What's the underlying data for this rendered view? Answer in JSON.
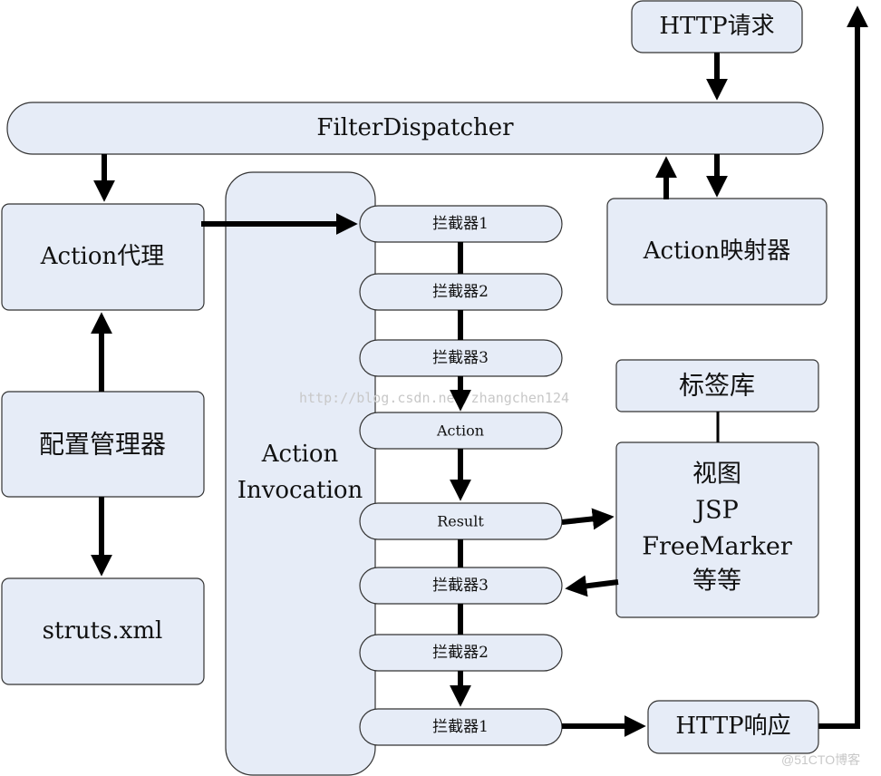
{
  "nodes": {
    "http_request": "HTTP请求",
    "filter_dispatcher": "FilterDispatcher",
    "action_proxy": "Action代理",
    "config_manager": "配置管理器",
    "struts_xml": "struts.xml",
    "action_invocation_line1": "Action",
    "action_invocation_line2": "Invocation",
    "action_mapper": "Action映射器",
    "tag_library": "标签库",
    "view_line1": "视图",
    "view_line2": "JSP",
    "view_line3": "FreeMarker",
    "view_line4": "等等",
    "http_response": "HTTP响应"
  },
  "chain": [
    "拦截器1",
    "拦截器2",
    "拦截器3",
    "Action",
    "Result",
    "拦截器3",
    "拦截器2",
    "拦截器1"
  ],
  "watermarks": {
    "blog": "http://blog.csdn.net/zhangchen124",
    "site": "@51CTO博客"
  },
  "colors": {
    "box_fill": "#e6ecf7",
    "arrow": "#000000"
  }
}
